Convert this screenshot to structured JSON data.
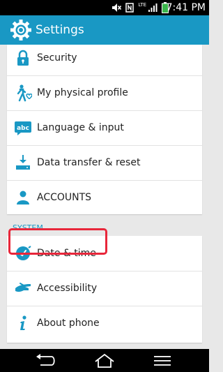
{
  "status_bar": {
    "network": "LTE",
    "time": "7:41 PM"
  },
  "header": {
    "title": "Settings",
    "icon": "gear-icon"
  },
  "settings_items": [
    {
      "label": "Security",
      "icon": "lock-icon"
    },
    {
      "label": "My physical profile",
      "icon": "walking-person-icon"
    },
    {
      "label": "Language & input",
      "icon": "keyboard-abc-icon"
    },
    {
      "label": "Data transfer & reset",
      "icon": "download-tray-icon"
    },
    {
      "label": "ACCOUNTS",
      "icon": "person-icon"
    }
  ],
  "system_section": {
    "header": "SYSTEM",
    "items": [
      {
        "label": "Date & time",
        "icon": "clock-icon"
      },
      {
        "label": "Accessibility",
        "icon": "hand-icon"
      },
      {
        "label": "About phone",
        "icon": "info-icon"
      }
    ]
  },
  "colors": {
    "accent": "#1998c4",
    "highlight": "#e8263a"
  }
}
